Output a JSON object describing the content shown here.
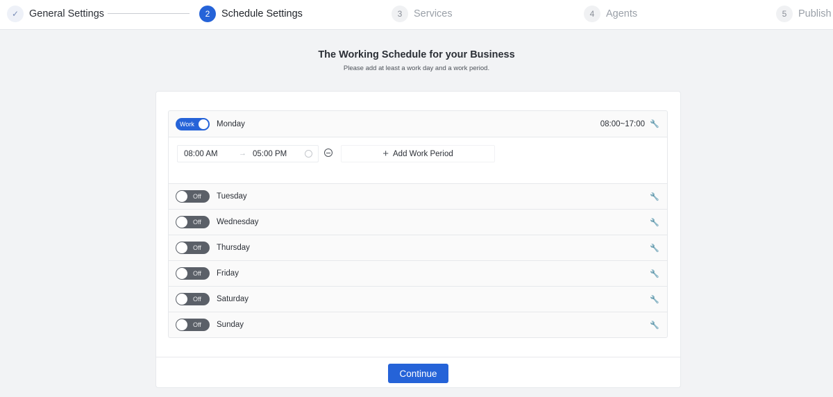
{
  "steps": [
    {
      "number": "✓",
      "label": "General Settings",
      "state": "done",
      "icon": "check-icon"
    },
    {
      "number": "2",
      "label": "Schedule Settings",
      "state": "active"
    },
    {
      "number": "3",
      "label": "Services",
      "state": "pending"
    },
    {
      "number": "4",
      "label": "Agents",
      "state": "pending"
    },
    {
      "number": "5",
      "label": "Publish",
      "state": "pending"
    }
  ],
  "header": {
    "title": "The Working Schedule for your Business",
    "subtitle": "Please add at least a work day and a work period."
  },
  "days": [
    {
      "name": "Monday",
      "enabled": true,
      "toggle_label": "Work",
      "range": "08:00~17:00"
    },
    {
      "name": "Tuesday",
      "enabled": false,
      "toggle_label": "Off"
    },
    {
      "name": "Wednesday",
      "enabled": false,
      "toggle_label": "Off"
    },
    {
      "name": "Thursday",
      "enabled": false,
      "toggle_label": "Off"
    },
    {
      "name": "Friday",
      "enabled": false,
      "toggle_label": "Off"
    },
    {
      "name": "Saturday",
      "enabled": false,
      "toggle_label": "Off"
    },
    {
      "name": "Sunday",
      "enabled": false,
      "toggle_label": "Off"
    }
  ],
  "period": {
    "start": "08:00 AM",
    "end": "05:00 PM",
    "arrow": "→",
    "add_label": "Add Work Period",
    "add_icon": "+"
  },
  "icons": {
    "edit": "wrench-icon",
    "wrench_glyph": "🔧"
  },
  "footer": {
    "continue_label": "Continue"
  },
  "colors": {
    "accent": "#2563d8",
    "toggle_off": "#5b6068"
  }
}
